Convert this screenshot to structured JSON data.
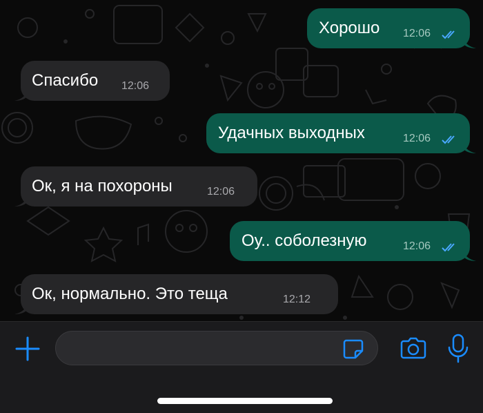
{
  "messages": [
    {
      "direction": "outgoing",
      "text": "Хорошо",
      "time": "12:06",
      "status": "read"
    },
    {
      "direction": "incoming",
      "text": "Спасибо",
      "time": "12:06"
    },
    {
      "direction": "outgoing",
      "text": "Удачных выходных",
      "time": "12:06",
      "status": "read"
    },
    {
      "direction": "incoming",
      "text": "Ок, я на похороны",
      "time": "12:06"
    },
    {
      "direction": "outgoing",
      "text": "Оу.. соболезную",
      "time": "12:06",
      "status": "read"
    },
    {
      "direction": "incoming",
      "text": "Ок, нормально. Это теща",
      "time": "12:12"
    }
  ],
  "composer": {
    "input_value": "",
    "icons": {
      "attach": "plus-icon",
      "sticker": "sticker-icon",
      "camera": "camera-icon",
      "mic": "microphone-icon"
    }
  },
  "colors": {
    "background": "#0a0a0a",
    "incoming_bubble": "#262628",
    "outgoing_bubble": "#0b5a4a",
    "accent": "#1a8cff",
    "read_ticks": "#4aa8ff"
  }
}
